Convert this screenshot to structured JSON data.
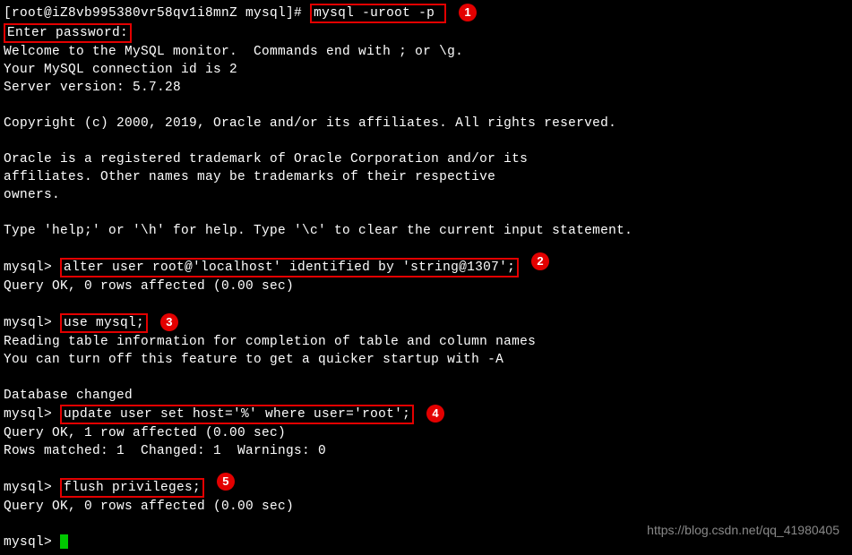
{
  "annotations": {
    "b1": "1",
    "b2": "2",
    "b3": "3",
    "b4": "4",
    "b5": "5"
  },
  "prompt": {
    "shell_prefix": "[root@iZ8vb995380vr58qv1i8mnZ mysql]# ",
    "mysql_prefix": "mysql> "
  },
  "cmd": {
    "login": "mysql -uroot -p ",
    "enter_password": "Enter password:",
    "alter_user": "alter user root@'localhost' identified by 'string@1307';",
    "use_mysql": "use mysql;",
    "update_user": "update user set host='%' where user='root';",
    "flush": "flush privileges;"
  },
  "out": {
    "welcome": "Welcome to the MySQL monitor.  Commands end with ; or \\g.",
    "conn_id": "Your MySQL connection id is 2",
    "server_ver": "Server version: 5.7.28",
    "copyright": "Copyright (c) 2000, 2019, Oracle and/or its affiliates. All rights reserved.",
    "trademark1": "Oracle is a registered trademark of Oracle Corporation and/or its",
    "trademark2": "affiliates. Other names may be trademarks of their respective",
    "trademark3": "owners.",
    "help": "Type 'help;' or '\\h' for help. Type '\\c' to clear the current input statement.",
    "query_ok_0": "Query OK, 0 rows affected (0.00 sec)",
    "reading1": "Reading table information for completion of table and column names",
    "reading2": "You can turn off this feature to get a quicker startup with -A",
    "db_changed": "Database changed",
    "query_ok_1": "Query OK, 1 row affected (0.00 sec)",
    "rows_matched": "Rows matched: 1  Changed: 1  Warnings: 0"
  },
  "watermark": "https://blog.csdn.net/qq_41980405"
}
